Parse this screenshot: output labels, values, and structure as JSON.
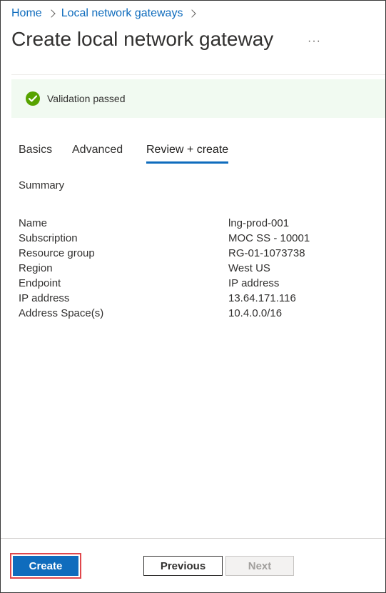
{
  "breadcrumb": {
    "home": "Home",
    "parent": "Local network gateways"
  },
  "header": {
    "title": "Create local network gateway",
    "more": "···"
  },
  "banner": {
    "text": "Validation passed",
    "color": "#57a300"
  },
  "tabs": [
    {
      "label": "Basics",
      "active": false
    },
    {
      "label": "Advanced",
      "active": false
    },
    {
      "label": "Review + create",
      "active": true
    }
  ],
  "summary": {
    "heading": "Summary",
    "rows": [
      {
        "key": "Name",
        "value": "lng-prod-001"
      },
      {
        "key": "Subscription",
        "value": "MOC SS - 10001"
      },
      {
        "key": "Resource group",
        "value": "RG-01-1073738"
      },
      {
        "key": "Region",
        "value": "West US"
      },
      {
        "key": "Endpoint",
        "value": "IP address"
      },
      {
        "key": "IP address",
        "value": "13.64.171.116"
      },
      {
        "key": "Address Space(s)",
        "value": "10.4.0.0/16"
      }
    ]
  },
  "footer": {
    "create": "Create",
    "previous": "Previous",
    "next": "Next"
  },
  "colors": {
    "accent": "#0f6cbd",
    "highlight": "#e0474c"
  }
}
